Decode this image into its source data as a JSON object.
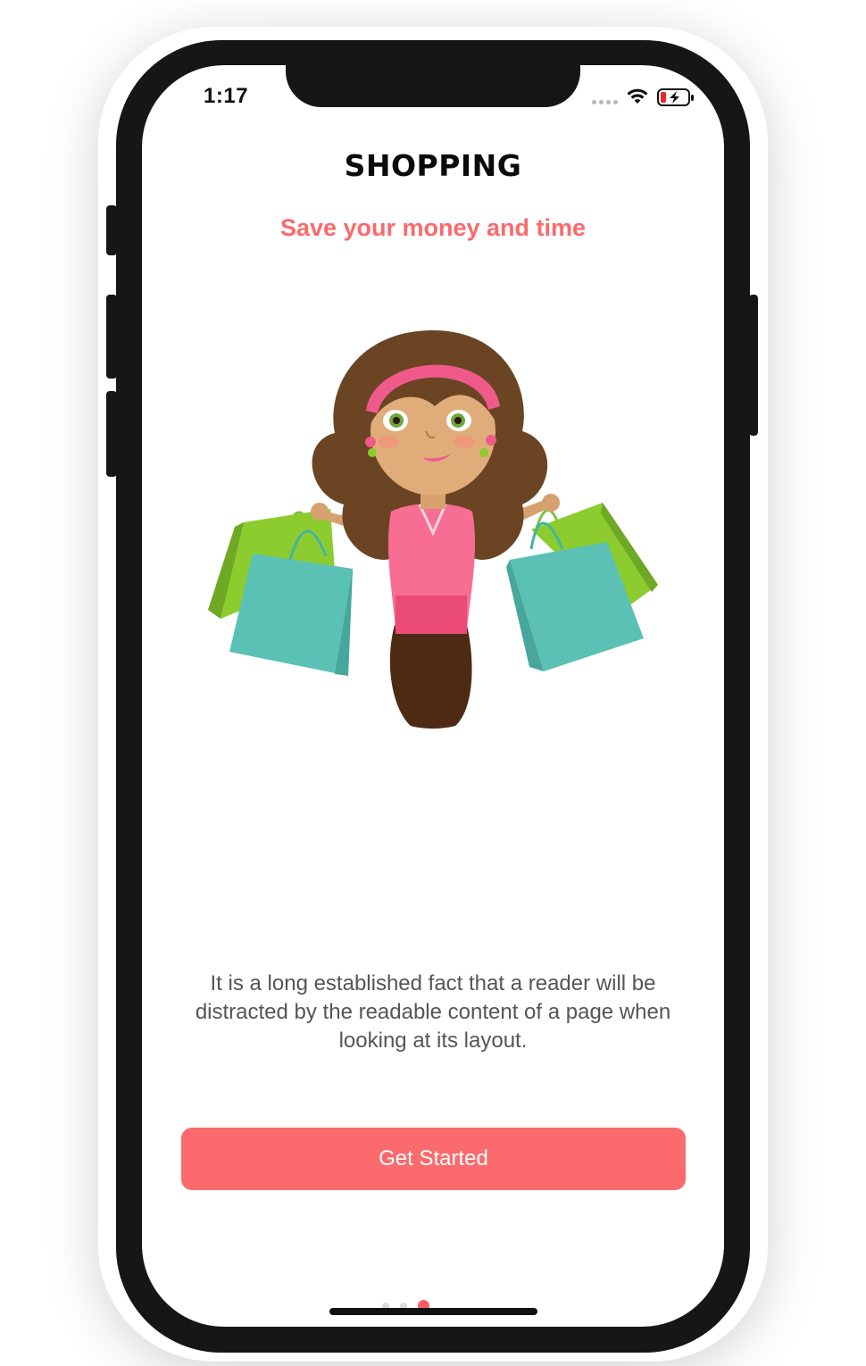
{
  "status_bar": {
    "time": "1:17",
    "icons": [
      "signal-dots-icon",
      "wifi-icon",
      "battery-charging-icon"
    ]
  },
  "onboarding": {
    "title": "SHOPPING",
    "subtitle": "Save your money and time",
    "illustration": "girl-with-shopping-bags",
    "description": "It is a long established fact that a reader will be distracted by the readable content of a page when looking at its layout.",
    "button_label": "Get Started"
  },
  "pager": {
    "total": 3,
    "active_index": 2
  },
  "colors": {
    "accent": "#fb6a6d",
    "title": "#0b0b0b",
    "body_text": "#555555",
    "frame": "#161616"
  }
}
